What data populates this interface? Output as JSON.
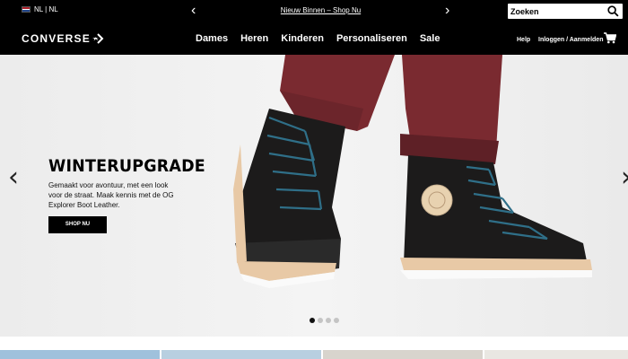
{
  "topbar": {
    "locale": "NL | NL",
    "promo": "Nieuw Binnen – Shop Nu",
    "prev_arrow": "‹",
    "next_arrow": "›",
    "search_placeholder": "Zoeken"
  },
  "nav": {
    "logo": "CONVERSE",
    "links": [
      "Dames",
      "Heren",
      "Kinderen",
      "Personaliseren",
      "Sale"
    ],
    "help": "Help",
    "login": "Inloggen / Aanmelden"
  },
  "hero": {
    "title": "WINTERUPGRADE",
    "body": "Gemaakt voor avontuur, met een look voor de straat. Maak kennis met de OG Explorer Boot Leather.",
    "cta": "SHOP NU",
    "prev_arrow": "‹",
    "next_arrow": "›",
    "slide_count": 4,
    "active_slide": 1
  },
  "icons": {
    "search": "search-icon",
    "cart": "cart-icon",
    "flag": "netherlands-flag-icon",
    "logo_mark": "converse-star-chevron-icon"
  },
  "colors": {
    "bar": "#000000",
    "hero_bg": "#efefef",
    "trouser": "#7a2a30",
    "boot": "#1c1b1b",
    "laces": "#2f6f88",
    "sole_tan": "#e8c9a6"
  }
}
